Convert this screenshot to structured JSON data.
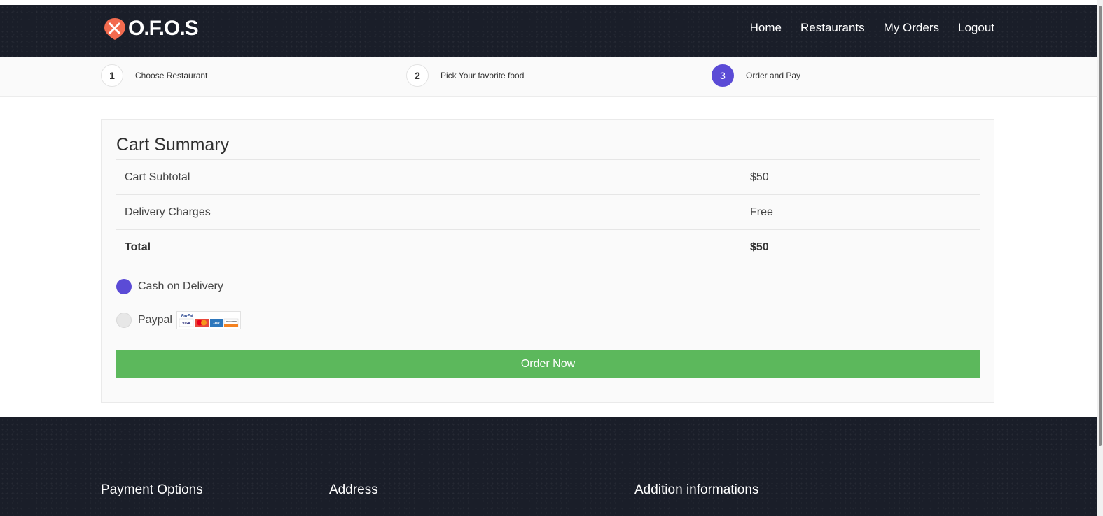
{
  "header": {
    "brand": "O.F.O.S",
    "nav": [
      "Home",
      "Restaurants",
      "My Orders",
      "Logout"
    ]
  },
  "steps": [
    {
      "number": "1",
      "label": "Choose Restaurant"
    },
    {
      "number": "2",
      "label": "Pick Your favorite food"
    },
    {
      "number": "3",
      "label": "Order and Pay"
    }
  ],
  "cart": {
    "title": "Cart Summary",
    "rows": [
      {
        "label": "Cart Subtotal",
        "value": "$50"
      },
      {
        "label": "Delivery Charges",
        "value": "Free"
      },
      {
        "label": "Total",
        "value": "$50"
      }
    ],
    "payment_options": [
      {
        "label": "Cash on Delivery",
        "selected": true
      },
      {
        "label": "Paypal",
        "selected": false
      }
    ],
    "card_logos": [
      "PayPal",
      "VISA",
      "MasterCard",
      "AMEX",
      "DISCOVER"
    ],
    "order_button": "Order Now"
  },
  "footer": {
    "headings": [
      "Payment Options",
      "Address",
      "Addition informations"
    ]
  },
  "colors": {
    "header_bg": "#1a1e29",
    "accent": "#5b4bd6",
    "order_button": "#5cb85c",
    "logo": "#f26b4f"
  },
  "icons": {
    "logo": "fork-knife-pin-icon"
  }
}
